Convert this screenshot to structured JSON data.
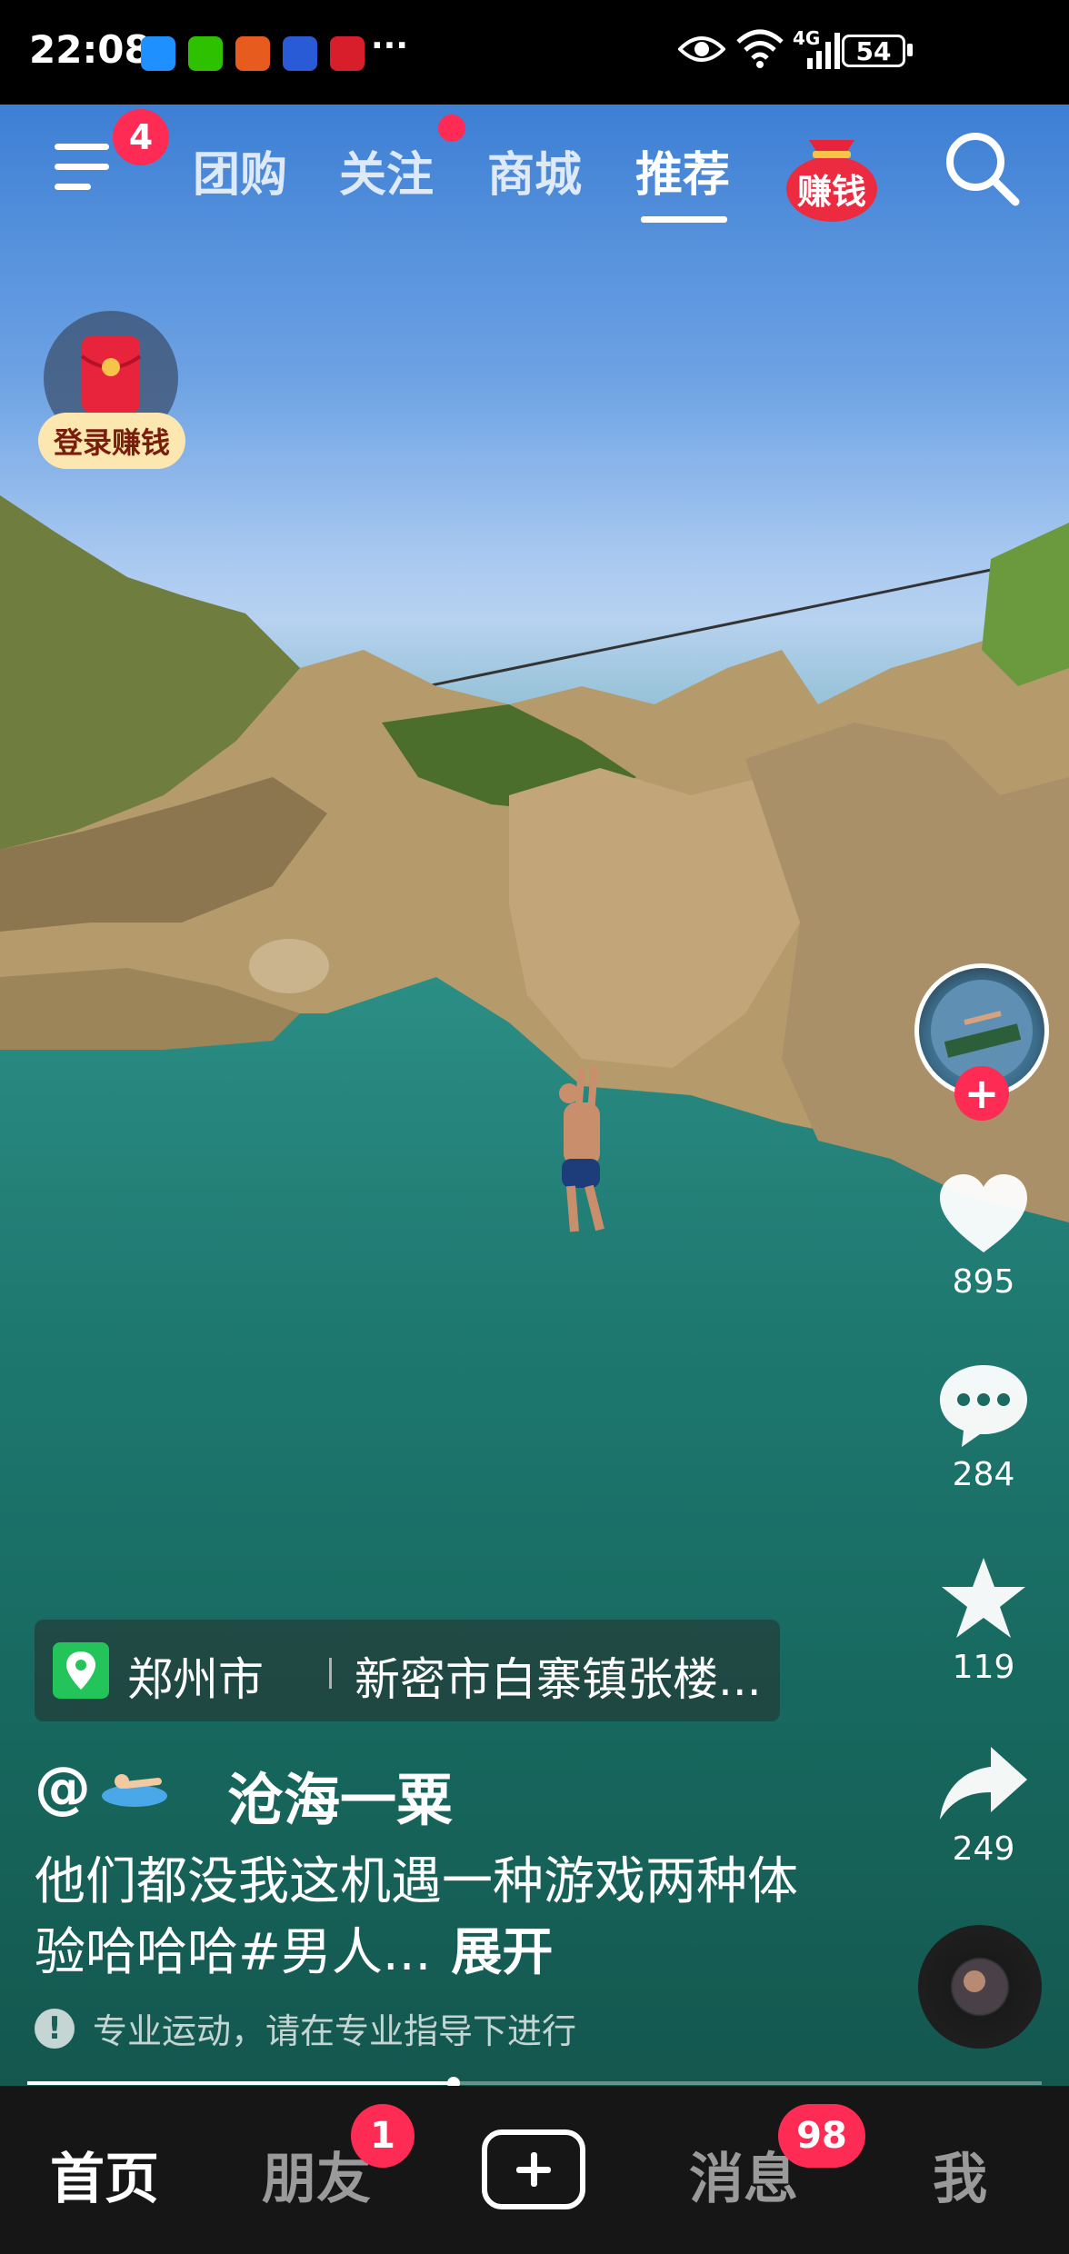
{
  "status_bar": {
    "time": "22:08",
    "network": "4G",
    "battery": "54",
    "more": "···"
  },
  "top_nav": {
    "menu_badge": "4",
    "tabs": [
      {
        "label": "团购",
        "active": false
      },
      {
        "label": "关注",
        "active": false,
        "dot": true
      },
      {
        "label": "商城",
        "active": false
      },
      {
        "label": "推荐",
        "active": true
      }
    ],
    "earn_label": "赚钱"
  },
  "login_earn": {
    "label": "登录赚钱"
  },
  "rail": {
    "like_count": "895",
    "comment_count": "284",
    "favorite_count": "119",
    "share_count": "249"
  },
  "location": {
    "city": "郑州市",
    "place": "新密市白寨镇张楼..."
  },
  "author": {
    "at": "@",
    "name": "沧海一粟"
  },
  "caption": {
    "text": "他们都没我这机遇一种游戏两种体验哈哈哈#男人...",
    "expand": "展开"
  },
  "warning": {
    "text": "专业运动，请在专业指导下进行"
  },
  "progress": {
    "fraction": 0.42
  },
  "bottom_nav": {
    "home": "首页",
    "friends": "朋友",
    "friends_badge": "1",
    "messages": "消息",
    "messages_badge": "98",
    "me": "我"
  },
  "colors": {
    "accent": "#fe2c55",
    "tabbar": "#161616",
    "location_pin": "#23c45a"
  }
}
